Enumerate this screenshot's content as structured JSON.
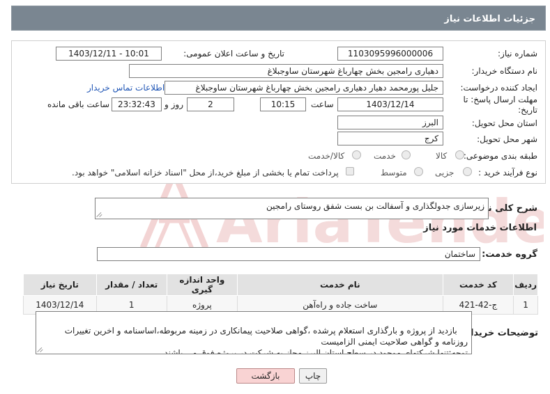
{
  "header": {
    "title": "جزئیات اطلاعات نیاز"
  },
  "fields": {
    "need_number_label": "شماره نیاز:",
    "need_number": "1103095996000006",
    "announce_label": "تاریخ و ساعت اعلان عمومی:",
    "announce_value": "1403/12/11 - 10:01",
    "buyer_org_label": "نام دستگاه خریدار:",
    "buyer_org": "دهیاری رامجین بخش چهارباغ شهرستان ساوجبلاغ",
    "creator_label": "ایجاد کننده درخواست:",
    "creator": "جلیل پورمحمد دهیار دهیاری رامجین بخش چهارباغ شهرستان ساوجبلاغ",
    "contact_link": "اطلاعات تماس خریدار",
    "deadline_label": "مهلت ارسال پاسخ: تا تاریخ:",
    "deadline_date": "1403/12/14",
    "time_label": "ساعت",
    "deadline_time": "10:15",
    "days_value": "2",
    "days_label": "روز و",
    "remaining_time": "23:32:43",
    "remaining_label": "ساعت باقی مانده",
    "province_label": "استان محل تحویل:",
    "province": "البرز",
    "city_label": "شهر محل تحویل:",
    "city": "کرج",
    "category_label": "طبقه بندی موضوعی:",
    "category_options": [
      "کالا",
      "خدمت",
      "کالا/خدمت"
    ],
    "purchase_type_label": "نوع فرآیند خرید :",
    "purchase_type_options": [
      "جزیی",
      "متوسط"
    ],
    "payment_note": "پرداخت تمام یا بخشی از مبلغ خرید،از محل \"اسناد خزانه اسلامی\" خواهد بود."
  },
  "summary": {
    "label": "شرح کلی نیاز:",
    "text": "زیرسازی جدولگذاری و آسفالت بن بست شفق روستای رامجین"
  },
  "services": {
    "section_title": "اطلاعات خدمات مورد نیاز",
    "group_label": "گروه خدمت:",
    "group_value": "ساختمان",
    "columns": [
      "ردیف",
      "کد خدمت",
      "نام خدمت",
      "واحد اندازه گیری",
      "تعداد / مقدار",
      "تاریخ نیاز"
    ],
    "rows": [
      [
        "1",
        "ج-42-421",
        "ساخت جاده و راه‌آهن",
        "پروژه",
        "1",
        "1403/12/14"
      ]
    ]
  },
  "buyer_notes": {
    "label": "توضیحات خریدار:",
    "text": "بازدید از پروژه و بارگذاری استعلام پرشده ،گواهی صلاحیت پیمانکاری در زمینه مربوطه،اساسنامه و اخرین تغییرات روزنامه و گواهی صلاحیت ایمنی الزامیست\nتوجه:تنها شرکتهای موجود در سطح استان البرز مجاز به شرکت در پروژه فوق می باشند."
  },
  "buttons": {
    "print": "چاپ",
    "back": "بازگشت"
  },
  "watermark": {
    "brand": "AriaTender.neT"
  },
  "colors": {
    "header_bg": "#7a8691",
    "link": "#1f55b5",
    "back_button": "#f9d3d3",
    "watermark": "#e6a5a5"
  }
}
